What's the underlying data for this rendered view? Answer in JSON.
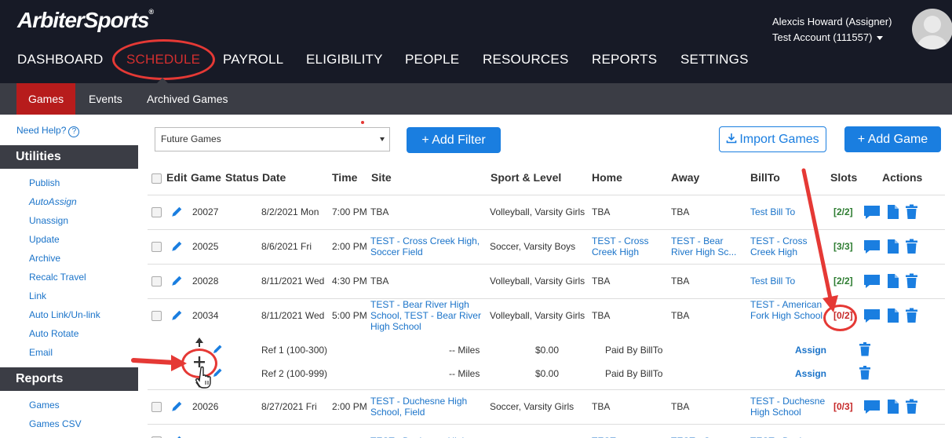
{
  "header": {
    "logo_part1": "Arbiter",
    "logo_part2": "Sports",
    "logo_mark": "®",
    "user_name": "Alexcis Howard (Assigner)",
    "account": "Test Account (111557)"
  },
  "main_nav": [
    {
      "label": "DASHBOARD",
      "active": false
    },
    {
      "label": "SCHEDULE",
      "active": true
    },
    {
      "label": "PAYROLL",
      "active": false
    },
    {
      "label": "ELIGIBILITY",
      "active": false
    },
    {
      "label": "PEOPLE",
      "active": false
    },
    {
      "label": "RESOURCES",
      "active": false
    },
    {
      "label": "REPORTS",
      "active": false
    },
    {
      "label": "SETTINGS",
      "active": false
    }
  ],
  "sub_nav": [
    {
      "label": "Games",
      "active": true
    },
    {
      "label": "Events",
      "active": false
    },
    {
      "label": "Archived Games",
      "active": false
    }
  ],
  "sidebar": {
    "help": "Need Help?",
    "utilities_title": "Utilities",
    "utilities": [
      "Publish",
      "AutoAssign",
      "Unassign",
      "Update",
      "Archive",
      "Recalc Travel",
      "Link",
      "Auto Link/Un-link",
      "Auto Rotate",
      "Email"
    ],
    "reports_title": "Reports",
    "reports": [
      "Games",
      "Games CSV"
    ]
  },
  "toolbar": {
    "filter_select": "Future Games",
    "add_filter": "+ Add Filter",
    "import_games": "Import Games",
    "add_game": "+ Add Game"
  },
  "table": {
    "headers": [
      "Edit",
      "Game",
      "Status",
      "Date",
      "Time",
      "Site",
      "Sport & Level",
      "Home",
      "Away",
      "BillTo",
      "Slots",
      "Actions"
    ],
    "rows": [
      {
        "game": "20027",
        "date": "8/2/2021 Mon",
        "time": "7:00 PM",
        "site": "TBA",
        "sport": "Volleyball, Varsity Girls",
        "home": "TBA",
        "away": "TBA",
        "billto": "Test Bill To",
        "slots": "[2/2]"
      },
      {
        "game": "20025",
        "date": "8/6/2021 Fri",
        "time": "2:00 PM",
        "site": "TEST - Cross Creek High, Soccer Field",
        "sport": "Soccer, Varsity Boys",
        "home": "TEST - Cross Creek High",
        "away": "TEST - Bear River High Sc...",
        "billto": "TEST - Cross Creek High",
        "slots": "[3/3]"
      },
      {
        "game": "20028",
        "date": "8/11/2021 Wed",
        "time": "4:30 PM",
        "site": "TBA",
        "sport": "Volleyball, Varsity Girls",
        "home": "TBA",
        "away": "TBA",
        "billto": "Test Bill To",
        "slots": "[2/2]"
      },
      {
        "game": "20034",
        "date": "8/11/2021 Wed",
        "time": "5:00 PM",
        "site": "TEST - Bear River High School, TEST - Bear River High School",
        "sport": "Volleyball, Varsity Girls",
        "home": "TBA",
        "away": "TBA",
        "billto": "TEST - American Fork High School",
        "slots": "[0/2]"
      },
      {
        "game": "20026",
        "date": "8/27/2021 Fri",
        "time": "2:00 PM",
        "site": "TEST - Duchesne High School, Field",
        "sport": "Soccer, Varsity Girls",
        "home": "TBA",
        "away": "TBA",
        "billto": "TEST - Duchesne High School",
        "slots": "[0/3]"
      },
      {
        "game": "",
        "date": "",
        "time": "",
        "site": "TEST - Duchesne High",
        "sport": "",
        "home": "TEST - Duchesne",
        "away": "TEST - Cross",
        "billto": "TEST - Duchesne",
        "slots": ""
      }
    ],
    "subrows": [
      {
        "position": "Ref 1 (100-300)",
        "miles": "-- Miles",
        "amount": "$0.00",
        "paid": "Paid By BillTo",
        "action": "Assign"
      },
      {
        "position": "Ref 2 (100-999)",
        "miles": "-- Miles",
        "amount": "$0.00",
        "paid": "Paid By BillTo",
        "action": "Assign"
      }
    ]
  },
  "colors": {
    "header_bg": "#171a26",
    "subnav_bg": "#3b3d45",
    "active_tab": "#b71c1c",
    "link": "#1a73c9",
    "button": "#1a7ee0",
    "annotation": "#e53935",
    "slot_full": "#2e7d32",
    "slot_open": "#c62828"
  },
  "icons": [
    "pencil-icon",
    "chat-icon",
    "document-icon",
    "trash-icon",
    "download-icon",
    "plus-icon",
    "hand-cursor-icon",
    "question-icon"
  ]
}
